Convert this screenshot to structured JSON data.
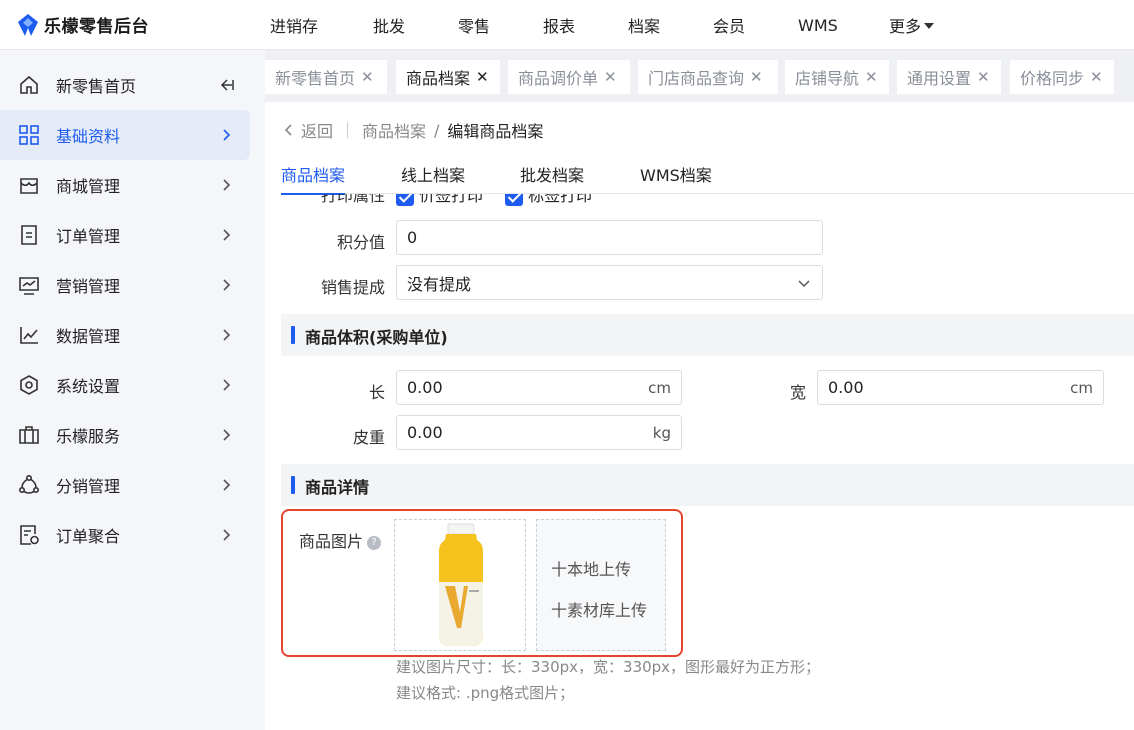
{
  "app": {
    "title": "乐檬零售后台"
  },
  "topnav": {
    "items": [
      "进销存",
      "批发",
      "零售",
      "报表",
      "档案",
      "会员",
      "WMS"
    ],
    "more": "更多"
  },
  "sidebar": {
    "items": [
      {
        "label": "新零售首页",
        "icon": "home-icon"
      },
      {
        "label": "基础资料",
        "icon": "grid-icon"
      },
      {
        "label": "商城管理",
        "icon": "store-icon"
      },
      {
        "label": "订单管理",
        "icon": "document-icon"
      },
      {
        "label": "营销管理",
        "icon": "monitor-chart-icon"
      },
      {
        "label": "数据管理",
        "icon": "line-chart-icon"
      },
      {
        "label": "系统设置",
        "icon": "settings-hexagon-icon"
      },
      {
        "label": "乐檬服务",
        "icon": "briefcase-icon"
      },
      {
        "label": "分销管理",
        "icon": "share-nodes-icon"
      },
      {
        "label": "订单聚合",
        "icon": "order-settings-icon"
      }
    ]
  },
  "tabs": [
    {
      "label": "新零售首页"
    },
    {
      "label": "商品档案"
    },
    {
      "label": "商品调价单"
    },
    {
      "label": "门店商品查询"
    },
    {
      "label": "店铺导航"
    },
    {
      "label": "通用设置"
    },
    {
      "label": "价格同步"
    }
  ],
  "breadcrumb": {
    "back": "返回",
    "parent": "商品档案",
    "current": "编辑商品档案"
  },
  "subtabs": [
    "商品档案",
    "线上档案",
    "批发档案",
    "WMS档案"
  ],
  "form": {
    "print_attr": {
      "label": "打印属性",
      "opt1": "价签打印",
      "opt2": "标签打印"
    },
    "points": {
      "label": "积分值",
      "value": "0"
    },
    "commission": {
      "label": "销售提成",
      "value": "没有提成"
    },
    "volume_section": "商品体积(采购单位)",
    "length": {
      "label": "长",
      "value": "0.00",
      "unit": "cm"
    },
    "width": {
      "label": "宽",
      "value": "0.00",
      "unit": "cm"
    },
    "tare": {
      "label": "皮重",
      "value": "0.00",
      "unit": "kg"
    },
    "detail_section": "商品详情",
    "image": {
      "label": "商品图片",
      "upload_local": "十本地上传",
      "upload_library": "十素材库上传",
      "hint1": "建议图片尺寸：长：330px，宽：330px，图形最好为正方形；",
      "hint2": "建议格式: .png格式图片；"
    }
  },
  "colors": {
    "accent": "#1e5cf0",
    "highlight": "#e5452f"
  }
}
